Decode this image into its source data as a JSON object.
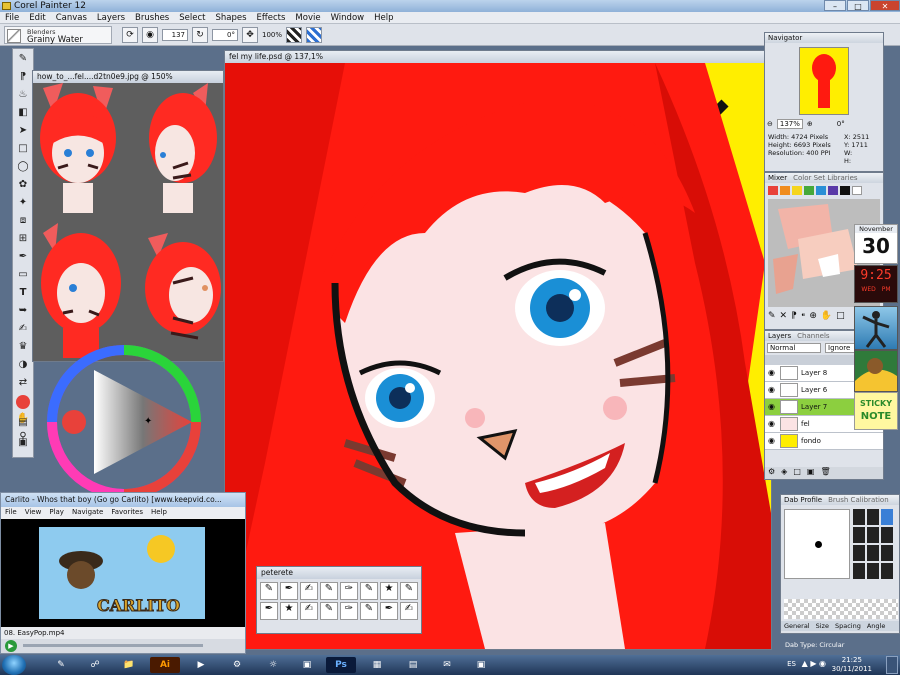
{
  "app": {
    "title": "Corel Painter 12"
  },
  "menu": [
    "File",
    "Edit",
    "Canvas",
    "Layers",
    "Brushes",
    "Select",
    "Shapes",
    "Effects",
    "Movie",
    "Window",
    "Help"
  ],
  "property_bar": {
    "brush_category": "Blenders",
    "brush_variant": "Grainy Water",
    "size": "137",
    "angle": "0°",
    "zoom": "100%"
  },
  "reference_window": {
    "title": "how_to_...fel....d2tn0e9.jpg @ 150%"
  },
  "document": {
    "title": "fel my life.psd @ 137,1%"
  },
  "navigator": {
    "title": "Navigator",
    "zoom": "137%",
    "angle": "0°",
    "width": "Width: 4724 Pixels",
    "height": "Height: 6693 Pixels",
    "resolution": "Resolution: 400 PPI",
    "x": "X: 2511",
    "y": "Y: 1711",
    "w": "W:",
    "h": "H:"
  },
  "mixer": {
    "tabs": [
      "Mixer",
      "Color Set Libraries"
    ]
  },
  "layers": {
    "tabs": [
      "Layers",
      "Channels"
    ],
    "composite": "Normal",
    "ignore": "Ignore",
    "items": [
      {
        "name": "Layer 8",
        "selected": false
      },
      {
        "name": "Layer 6",
        "selected": false
      },
      {
        "name": "Layer 7",
        "selected": true
      },
      {
        "name": "fel",
        "selected": false
      },
      {
        "name": "fondo",
        "selected": false
      }
    ]
  },
  "dab": {
    "tabs": [
      "Dab Profile",
      "Brush Calibration"
    ],
    "general_tabs": [
      "General",
      "Size",
      "Spacing",
      "Angle"
    ],
    "dab_type": "Dab Type: Circular"
  },
  "brush_palette": {
    "title": "peterete"
  },
  "media_player": {
    "title": "Carlito - Whos that boy (Go go Carlito) [www.keepvid.co...",
    "menu": [
      "File",
      "View",
      "Play",
      "Navigate",
      "Favorites",
      "Help"
    ],
    "now_playing": "08. EasyPop.mp4",
    "video_text": "CARLITO"
  },
  "calendar": {
    "month": "November",
    "day": "30"
  },
  "gadget_clock": {
    "time": "9:25",
    "day": "WED",
    "ampm": "PM"
  },
  "sticky": {
    "line1": "STICKY",
    "line2": "NOTE"
  },
  "taskbar": {
    "lang": "ES",
    "time": "21:25",
    "date": "30/11/2011",
    "ai_label": "Ai",
    "ps_label": "Ps"
  },
  "colors": {
    "main_color": "#e8413a",
    "accent": "#8ccf3f"
  }
}
